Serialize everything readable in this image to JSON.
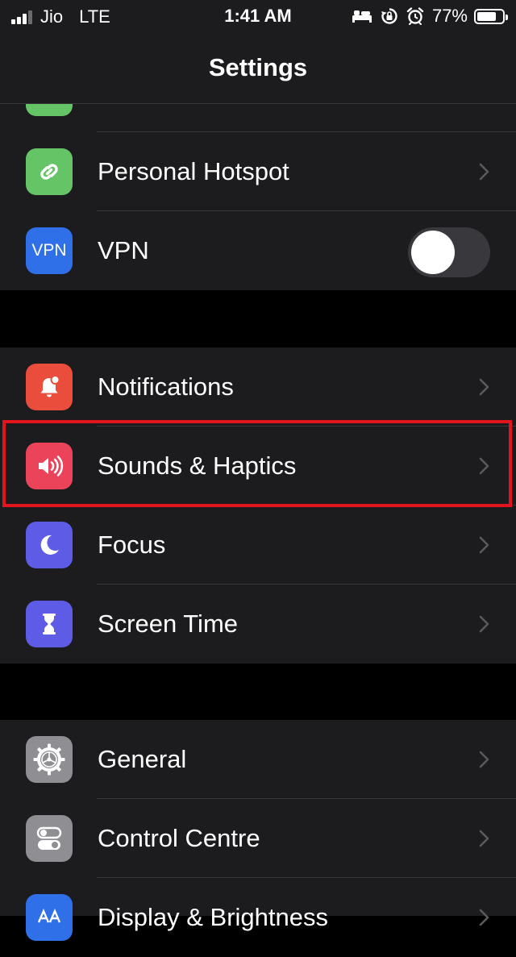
{
  "status_bar": {
    "carrier": "Jio",
    "network": "LTE",
    "time": "1:41 AM",
    "battery_percent": "77%",
    "battery_level": 0.77,
    "icons": [
      "bed-icon",
      "orientation-lock-icon",
      "alarm-icon"
    ]
  },
  "nav": {
    "title": "Settings"
  },
  "groups": [
    {
      "items": [
        {
          "label": "Personal Hotspot",
          "icon": "hotspot-icon",
          "icon_color": "#65c466",
          "accessory": "chevron"
        },
        {
          "label": "VPN",
          "icon": "vpn-icon",
          "icon_text": "VPN",
          "icon_color": "#2f6fe8",
          "accessory": "toggle",
          "toggle_on": false
        }
      ]
    },
    {
      "items": [
        {
          "label": "Notifications",
          "icon": "notifications-icon",
          "icon_color": "#eb4d3d",
          "accessory": "chevron"
        },
        {
          "label": "Sounds & Haptics",
          "icon": "speaker-icon",
          "icon_color": "#eb445a",
          "accessory": "chevron",
          "highlighted": true
        },
        {
          "label": "Focus",
          "icon": "moon-icon",
          "icon_color": "#5e5ce6",
          "accessory": "chevron"
        },
        {
          "label": "Screen Time",
          "icon": "hourglass-icon",
          "icon_color": "#5e5ce6",
          "accessory": "chevron"
        }
      ]
    },
    {
      "items": [
        {
          "label": "General",
          "icon": "gear-icon",
          "icon_color": "#8e8e93",
          "accessory": "chevron"
        },
        {
          "label": "Control Centre",
          "icon": "switches-icon",
          "icon_color": "#8e8e93",
          "accessory": "chevron"
        },
        {
          "label": "Display & Brightness",
          "icon": "display-icon",
          "icon_color": "#2f6fe8",
          "accessory": "chevron"
        }
      ]
    }
  ],
  "colors": {
    "background": "#000000",
    "cell": "#1c1c1e",
    "separator": "#38383a",
    "chevron": "#5a5a5e",
    "highlight": "#e3141c"
  }
}
